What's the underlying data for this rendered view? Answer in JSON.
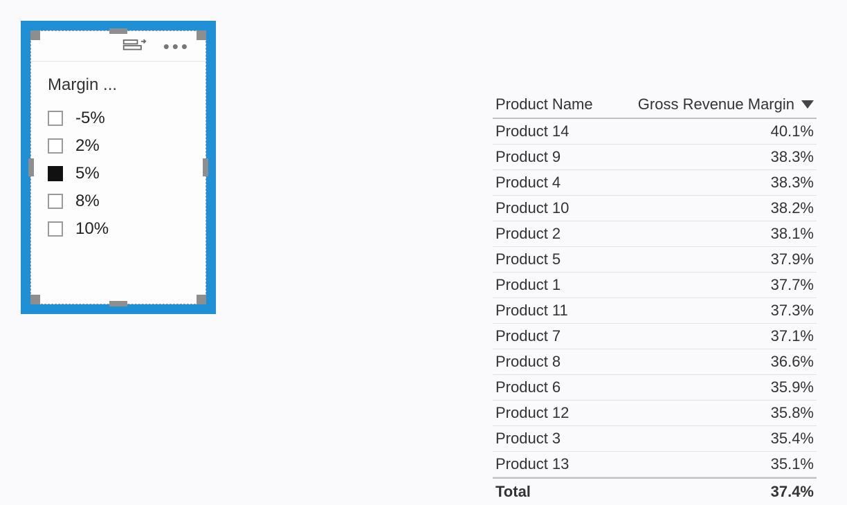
{
  "slicer": {
    "title": "Margin ...",
    "options": [
      {
        "label": "-5%",
        "checked": false
      },
      {
        "label": "2%",
        "checked": false
      },
      {
        "label": "5%",
        "checked": true
      },
      {
        "label": "8%",
        "checked": false
      },
      {
        "label": "10%",
        "checked": false
      }
    ]
  },
  "table": {
    "columns": {
      "c1": "Product Name",
      "c2": "Gross Revenue Margin"
    },
    "sort": {
      "column": "c2",
      "direction": "desc"
    },
    "rows": [
      {
        "name": "Product 14",
        "value": "40.1%"
      },
      {
        "name": "Product 9",
        "value": "38.3%"
      },
      {
        "name": "Product 4",
        "value": "38.3%"
      },
      {
        "name": "Product 10",
        "value": "38.2%"
      },
      {
        "name": "Product 2",
        "value": "38.1%"
      },
      {
        "name": "Product 5",
        "value": "37.9%"
      },
      {
        "name": "Product 1",
        "value": "37.7%"
      },
      {
        "name": "Product 11",
        "value": "37.3%"
      },
      {
        "name": "Product 7",
        "value": "37.1%"
      },
      {
        "name": "Product 8",
        "value": "36.6%"
      },
      {
        "name": "Product 6",
        "value": "35.9%"
      },
      {
        "name": "Product 12",
        "value": "35.8%"
      },
      {
        "name": "Product 3",
        "value": "35.4%"
      },
      {
        "name": "Product 13",
        "value": "35.1%"
      }
    ],
    "total": {
      "label": "Total",
      "value": "37.4%"
    }
  }
}
